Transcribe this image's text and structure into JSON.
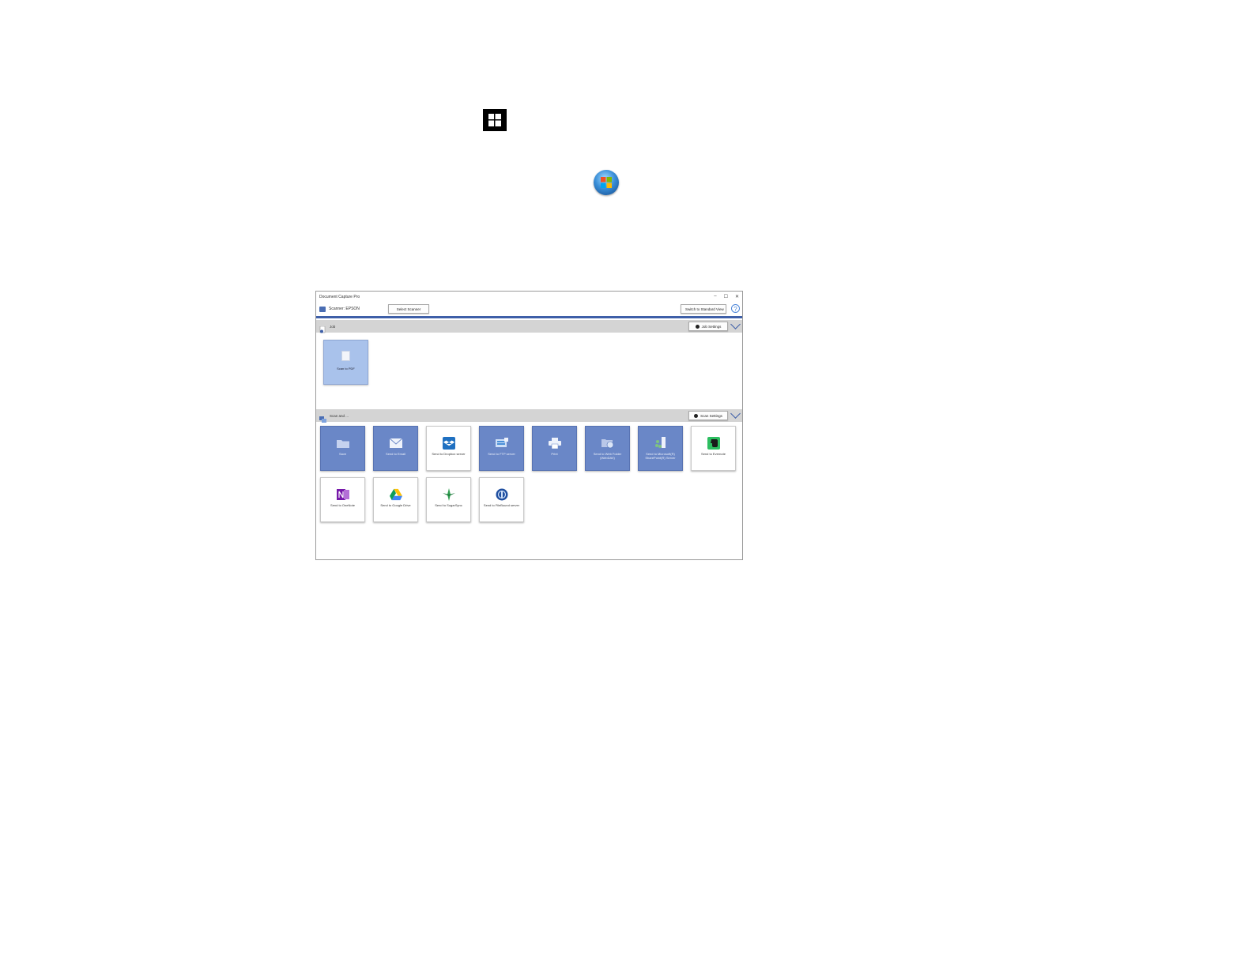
{
  "window": {
    "title": "Document Capture Pro",
    "controls": {
      "minimize": "–",
      "maximize": "☐",
      "close": "✕"
    }
  },
  "toolbar": {
    "scanner_label": "Scanner: EPSON",
    "select_scanner": "Select Scanner",
    "switch_view": "Switch to Standard View",
    "help": "?"
  },
  "job_section": {
    "header_label": "Job",
    "settings_label": "Job Settings",
    "jobs": [
      {
        "label": "Scan to PDF"
      }
    ]
  },
  "scan_and_section": {
    "header_label": "Scan and ...",
    "settings_label": "Scan Settings",
    "destinations": [
      {
        "label": "Save",
        "icon": "folder-icon",
        "style": "blue"
      },
      {
        "label": "Send to Email",
        "icon": "envelope-icon",
        "style": "blue"
      },
      {
        "label": "Send to Dropbox server",
        "icon": "dropbox-icon",
        "style": "white"
      },
      {
        "label": "Send to FTP server",
        "icon": "ftp-server-icon",
        "style": "blue"
      },
      {
        "label": "Print",
        "icon": "printer-icon",
        "style": "blue"
      },
      {
        "label": "Send to Web Folder (WebDAV)",
        "icon": "web-folder-icon",
        "style": "blue"
      },
      {
        "label": "Send to Microsoft(R) SharePoint(R) Server",
        "icon": "sharepoint-icon",
        "style": "blue"
      },
      {
        "label": "Send to Evernote",
        "icon": "evernote-icon",
        "style": "white"
      },
      {
        "label": "Send to OneNote",
        "icon": "onenote-icon",
        "style": "white"
      },
      {
        "label": "Send to Google Drive",
        "icon": "google-drive-icon",
        "style": "white"
      },
      {
        "label": "Send to SugarSync",
        "icon": "sugarsync-icon",
        "style": "white"
      },
      {
        "label": "Send to FileBound server",
        "icon": "filebound-icon",
        "style": "white"
      }
    ]
  },
  "colors": {
    "accent_blue": "#3e5fa8",
    "tile_blue": "#6a87c7",
    "job_tile": "#a9c2eb",
    "section_header": "#d4d4d4"
  },
  "floating_icons": [
    "windows-10-start-icon",
    "windows-7-start-icon"
  ]
}
